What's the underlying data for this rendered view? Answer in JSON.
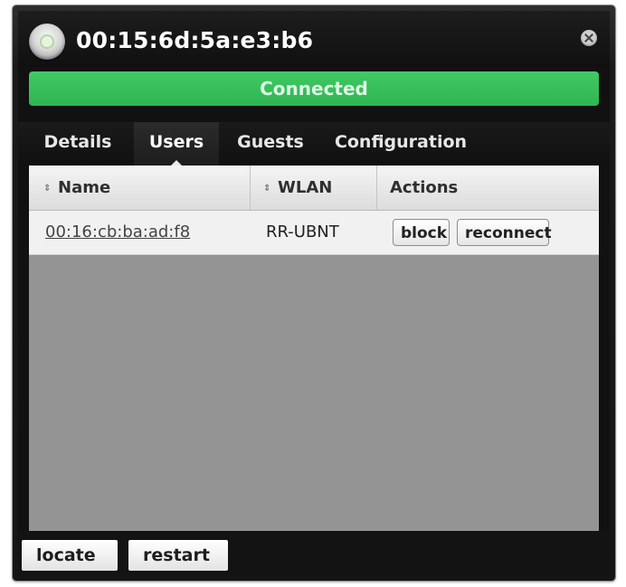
{
  "window": {
    "title": "00:15:6d:5a:e3:b6",
    "status": "Connected",
    "icons": {
      "status": "status-dot-icon",
      "close": "close-icon"
    },
    "colors": {
      "status_green": "#36bd58",
      "background": "#111111",
      "content_gray": "#949494"
    }
  },
  "tabs": [
    {
      "label": "Details",
      "active": false
    },
    {
      "label": "Users",
      "active": true
    },
    {
      "label": "Guests",
      "active": false
    },
    {
      "label": "Configuration",
      "active": false
    }
  ],
  "users_table": {
    "columns": [
      {
        "label": "Name",
        "sortable": true
      },
      {
        "label": "WLAN",
        "sortable": true
      },
      {
        "label": "Actions",
        "sortable": false
      }
    ],
    "rows": [
      {
        "name": "00:16:cb:ba:ad:f8",
        "wlan": "RR-UBNT",
        "actions": [
          "block",
          "reconnect"
        ]
      }
    ]
  },
  "footer": {
    "locate_label": "locate",
    "restart_label": "restart"
  }
}
